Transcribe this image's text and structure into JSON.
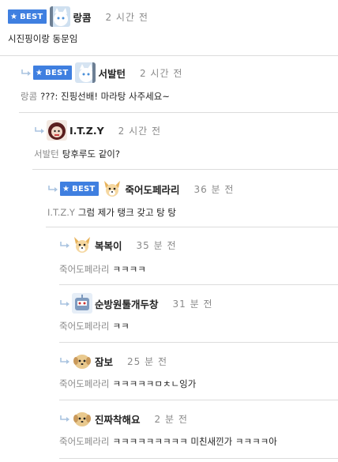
{
  "badge_label": "BEST",
  "comments": [
    {
      "nick": "랑콤",
      "time": "2 시간 전",
      "mention": "",
      "text": "시진핑이랑 동문임",
      "best": true,
      "avatar": "white-cat-avatar-icon"
    },
    {
      "nick": "서발턴",
      "time": "2 시간 전",
      "mention": "랑콤",
      "text": "???: 진핑선배! 마라탕 사주세요~",
      "best": true,
      "avatar": "white-cat-avatar-icon"
    },
    {
      "nick": "I.T.Z.Y",
      "time": "2 시간 전",
      "mention": "서발턴",
      "text": "탕후루도 같이?",
      "best": false,
      "avatar": "doll-avatar-icon"
    },
    {
      "nick": "죽어도페라리",
      "time": "36 분 전",
      "mention": "I.T.Z.Y",
      "text": "그럼 제가 탱크 갖고 탕 탕",
      "best": true,
      "avatar": "dog-avatar-icon"
    },
    {
      "nick": "복복이",
      "time": "35 분 전",
      "mention": "죽어도페라리",
      "text": "ㅋㅋㅋㅋ",
      "best": false,
      "avatar": "dog-avatar-icon"
    },
    {
      "nick": "순방원툴개두창",
      "time": "31 분 전",
      "mention": "죽어도페라리",
      "text": "ㅋㅋ",
      "best": false,
      "avatar": "robot-avatar-icon"
    },
    {
      "nick": "잠보",
      "time": "25 분 전",
      "mention": "죽어도페라리",
      "text": "ㅋㅋㅋㅋㅋㅁㅊㄴ잉가",
      "best": false,
      "avatar": "puppy-avatar-icon"
    },
    {
      "nick": "진짜착해요",
      "time": "2 분 전",
      "mention": "죽어도페라리",
      "text": "ㅋㅋㅋㅋㅋㅋㅋㅋㅋ 미친새낀가 ㅋㅋㅋㅋ아",
      "best": false,
      "avatar": "puppy-avatar-icon"
    }
  ]
}
